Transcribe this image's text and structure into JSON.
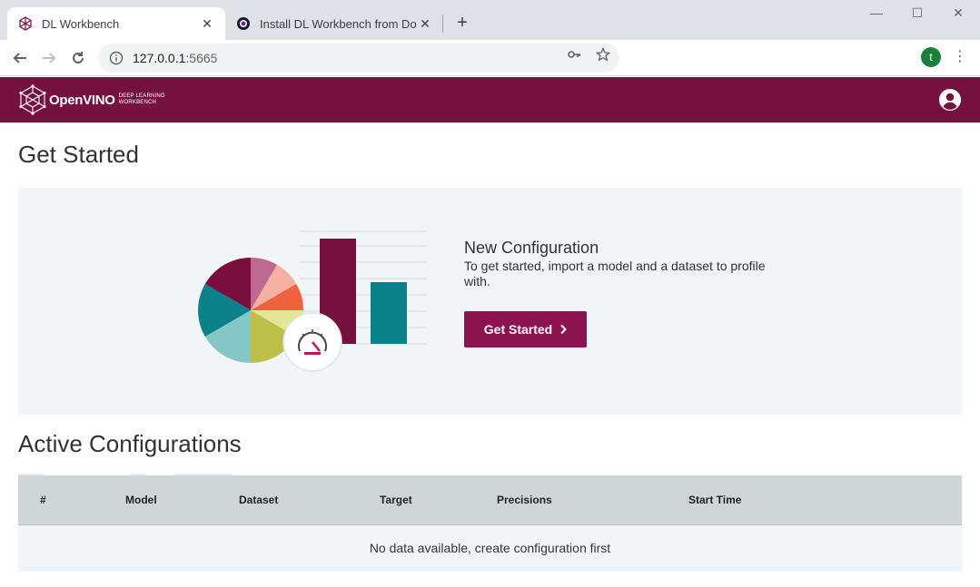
{
  "browser": {
    "tabs": [
      {
        "title": "DL Workbench",
        "active": true
      },
      {
        "title": "Install DL Workbench from Do",
        "active": false
      }
    ],
    "address": {
      "host": "127.0.0.1",
      "port": ":5665"
    },
    "profile_initial": "t"
  },
  "app": {
    "logo": {
      "brand": "OpenVINO",
      "sub_line1": "DEEP LEARNING",
      "sub_line2": "WORKBENCH"
    },
    "page_title": "Get Started",
    "new_configuration": {
      "title": "New Configuration",
      "description": "To get started, import a model and a dataset to profile with.",
      "button_label": "Get Started"
    },
    "active_configurations": {
      "title": "Active Configurations",
      "columns": [
        "#",
        "Model",
        "Dataset",
        "Target",
        "Precisions",
        "Start Time"
      ],
      "empty_message": "No data available, create configuration first"
    },
    "colors": {
      "header": "#76103f",
      "button": "#8c1250",
      "hero_bg": "#f2f5f7",
      "table_header": "#d0d6d8",
      "teal": "#0b8189"
    }
  }
}
